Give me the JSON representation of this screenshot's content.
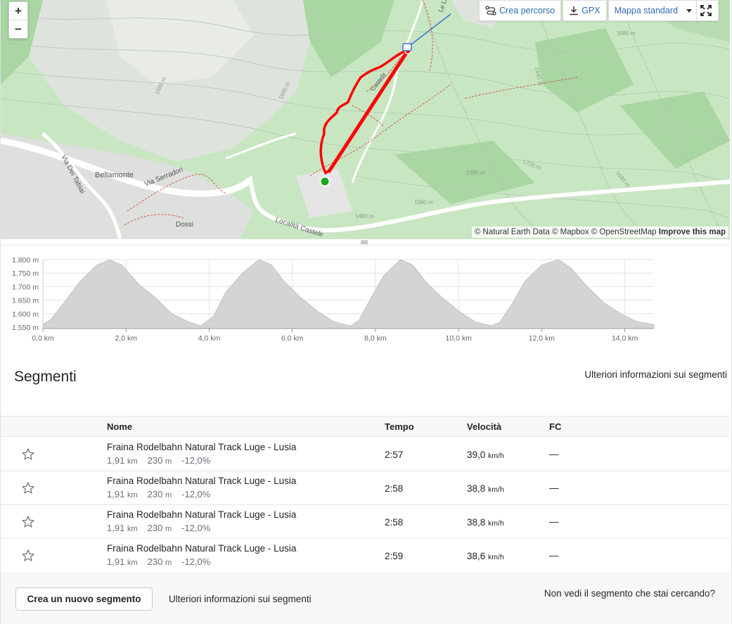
{
  "map": {
    "zoom_in": "+",
    "zoom_out": "−",
    "create_route": "Crea percorso",
    "gpx": "GPX",
    "map_type": "Mappa standard",
    "attribution": "© Natural Earth Data © Mapbox © OpenStreetMap",
    "improve": "Improve this map",
    "labels": {
      "bellamonte": "Bellamonte",
      "via_serradori": "Via Serradori",
      "via_dei_tabiai": "Via Dei Tabiai",
      "dossi": "Dossi",
      "localita_castelir": "Località Castelir",
      "castelir": "Castelir",
      "lele": "Le Le",
      "c1680a": "1680 m",
      "c1680b": "1680 m",
      "c1680c": "1680 m",
      "c1680d": "1680 m",
      "c1720": "1720 m",
      "c1840": "1840 m",
      "c1580": "1580 m",
      "c1480": "1480 m",
      "c1580b": "1580 m"
    }
  },
  "chart_data": {
    "type": "area",
    "x": [
      0.0,
      0.2,
      0.5,
      0.9,
      1.3,
      1.6,
      1.9,
      2.3,
      2.7,
      3.1,
      3.5,
      3.8,
      4.1,
      4.4,
      4.8,
      5.2,
      5.5,
      5.8,
      6.2,
      6.6,
      7.0,
      7.4,
      7.6,
      7.9,
      8.2,
      8.6,
      8.9,
      9.2,
      9.6,
      10.0,
      10.4,
      10.8,
      11.0,
      11.3,
      11.6,
      12.0,
      12.4,
      12.7,
      13.1,
      13.5,
      13.9,
      14.3,
      14.7
    ],
    "values": [
      1560,
      1580,
      1640,
      1720,
      1780,
      1800,
      1780,
      1710,
      1660,
      1600,
      1570,
      1555,
      1590,
      1680,
      1750,
      1800,
      1780,
      1720,
      1660,
      1610,
      1570,
      1555,
      1575,
      1660,
      1740,
      1800,
      1780,
      1720,
      1660,
      1610,
      1570,
      1555,
      1570,
      1640,
      1720,
      1780,
      1800,
      1770,
      1700,
      1640,
      1600,
      1570,
      1560
    ],
    "xlabel": "",
    "ylabel": "",
    "xlim": [
      0,
      14.7
    ],
    "ylim": [
      1545,
      1800
    ],
    "x_ticks": [
      "0,0 km",
      "2,0 km",
      "4,0 km",
      "6,0 km",
      "8,0 km",
      "10,0 km",
      "12,0 km",
      "14,0 km"
    ],
    "y_ticks": [
      "1.550 m",
      "1.600 m",
      "1.650 m",
      "1.700 m",
      "1.750 m",
      "1.800 m"
    ],
    "grid": true,
    "fill_color": "#d4d4d4"
  },
  "segments": {
    "title": "Segmenti",
    "more_info": "Ulteriori informazioni sui segmenti",
    "headers": {
      "name": "Nome",
      "time": "Tempo",
      "speed": "Velocità",
      "hr": "FC"
    },
    "rows": [
      {
        "name": "Fraina Rodelbahn Natural Track Luge - Lusia",
        "dist": "1,91",
        "dist_unit": "km",
        "elev": "230",
        "elev_unit": "m",
        "grade": "-12,0%",
        "time": "2:57",
        "speed": "39,0",
        "speed_unit": "km/h",
        "hr": "—"
      },
      {
        "name": "Fraina Rodelbahn Natural Track Luge - Lusia",
        "dist": "1,91",
        "dist_unit": "km",
        "elev": "230",
        "elev_unit": "m",
        "grade": "-12,0%",
        "time": "2:58",
        "speed": "38,8",
        "speed_unit": "km/h",
        "hr": "—"
      },
      {
        "name": "Fraina Rodelbahn Natural Track Luge - Lusia",
        "dist": "1,91",
        "dist_unit": "km",
        "elev": "230",
        "elev_unit": "m",
        "grade": "-12,0%",
        "time": "2:58",
        "speed": "38,8",
        "speed_unit": "km/h",
        "hr": "—"
      },
      {
        "name": "Fraina Rodelbahn Natural Track Luge - Lusia",
        "dist": "1,91",
        "dist_unit": "km",
        "elev": "230",
        "elev_unit": "m",
        "grade": "-12,0%",
        "time": "2:59",
        "speed": "38,6",
        "speed_unit": "km/h",
        "hr": "—"
      }
    ],
    "create_button": "Crea un nuovo segmento",
    "footer_more": "Ulteriori informazioni sui segmenti",
    "missing": "Non vedi il segmento che stai cercando?"
  },
  "colors": {
    "route": "#ff0000",
    "start": "#1aa71a",
    "link": "#2e6bb0"
  }
}
